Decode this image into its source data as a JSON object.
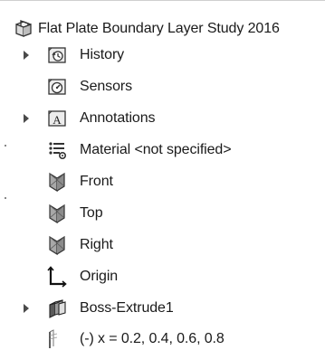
{
  "feature_tree": {
    "root": {
      "label": "Flat Plate Boundary Layer Study 2016",
      "icon": "part-icon"
    },
    "items": [
      {
        "label": "History",
        "icon": "history-icon",
        "expandable": true
      },
      {
        "label": "Sensors",
        "icon": "sensors-icon",
        "expandable": false
      },
      {
        "label": "Annotations",
        "icon": "annotations-icon",
        "expandable": true
      },
      {
        "label": "Material <not specified>",
        "icon": "material-icon",
        "expandable": false
      },
      {
        "label": "Front",
        "icon": "plane-icon",
        "expandable": false
      },
      {
        "label": "Top",
        "icon": "plane-icon",
        "expandable": false
      },
      {
        "label": "Right",
        "icon": "plane-icon",
        "expandable": false
      },
      {
        "label": "Origin",
        "icon": "origin-icon",
        "expandable": false
      },
      {
        "label": "Boss-Extrude1",
        "icon": "extrude-icon",
        "expandable": true
      },
      {
        "label": "(-) x = 0.2, 0.4, 0.6, 0.8",
        "icon": "sketch-icon",
        "expandable": false
      }
    ]
  },
  "colors": {
    "text": "#1a1a1a",
    "icon_stroke": "#333333",
    "icon_fill_light": "#e6e6e6",
    "plane_fill": "#9a9a9a"
  }
}
